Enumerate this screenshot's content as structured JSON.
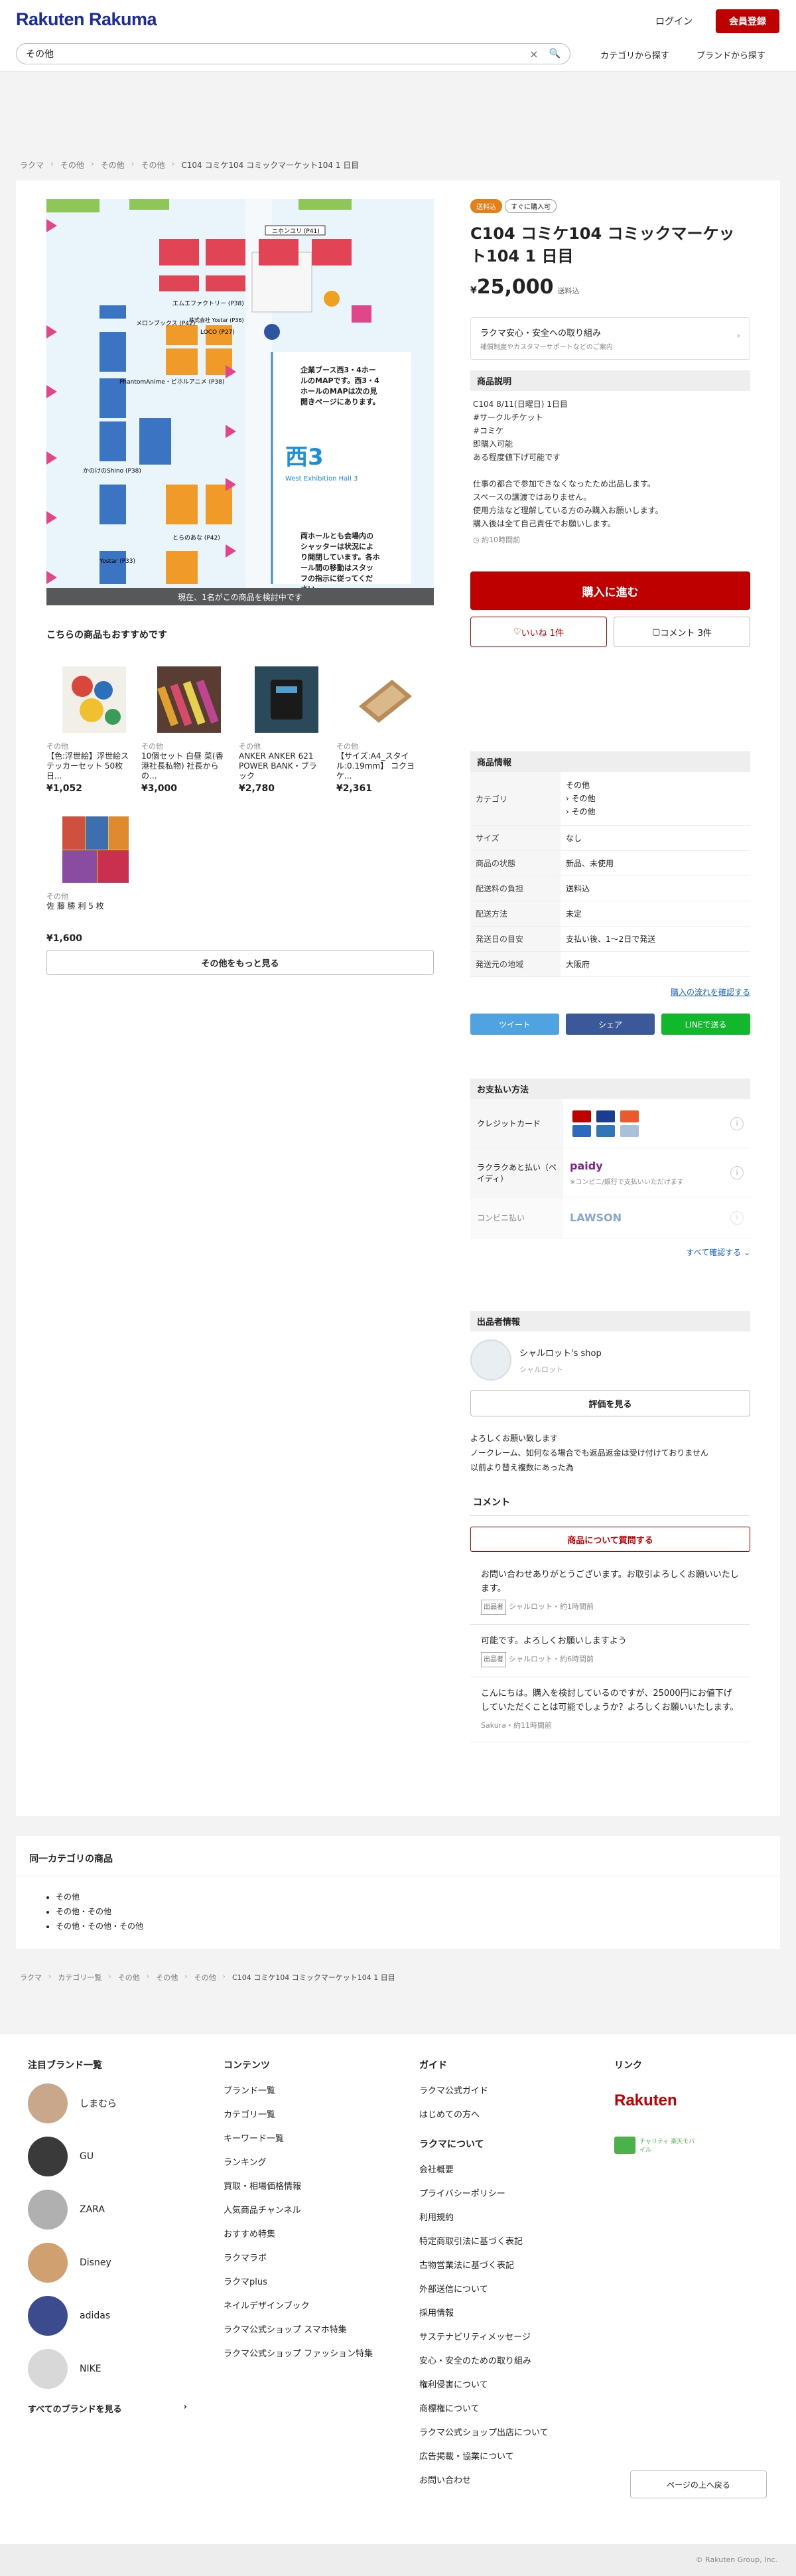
{
  "header": {
    "logo": "Rakuten Rakuma",
    "login": "ログイン",
    "register": "会員登録",
    "search_value": "その他",
    "clear_icon": "×",
    "search_icon": "🔍",
    "category_search": "カテゴリから探す",
    "brand_search": "ブランドから探す"
  },
  "breadcrumb_top": [
    "ラクマ",
    "その他",
    "その他",
    "その他",
    "C104 コミケ104 コミックマーケット104 1 日目"
  ],
  "photo": {
    "status": "現在、1名がこの商品を検討中です",
    "big_label": "西3",
    "hall_label": "West Exhibition Hall 3",
    "map_note1": "企業ブース西3・4ホールのMAPです。西3・4ホールのMAPは次の見開きページにあります。",
    "map_note2": "両ホールとも会場内のシャッターは状況により開閉しています。各ホール間の移動はスタッフの指示に従ってください。",
    "booths": [
      "ニホンユリ (P41)",
      "エムエファクトリー (P38)",
      "メロンブックス (P42)",
      "株式会社 Yostar (P36)",
      "LOCO (P27)",
      "PhantomAnime・ビホルアニメ (P38)",
      "かのけのShino (P38)",
      "とらのあな (P42)",
      "Yostar (P33)"
    ]
  },
  "recommend": {
    "title": "こちらの商品もおすすめです",
    "items": [
      {
        "cat": "その他",
        "name": "【色:浮世絵】浮世絵ステッカーセット 50枚 日...",
        "price": "¥1,052"
      },
      {
        "cat": "その他",
        "name": "10個セット 白昼 菜(香港社長私物) 社長からの...",
        "price": "¥3,000"
      },
      {
        "cat": "その他",
        "name": "ANKER ANKER 621 POWER BANK・ブラック",
        "price": "¥2,780"
      },
      {
        "cat": "その他",
        "name": "【サイズ:A4_スタイル:0.19mm】 コクヨ ケ...",
        "price": "¥2,361"
      },
      {
        "cat": "その他",
        "name": "佐 藤 勝 利 5 枚",
        "price": "¥1,600"
      }
    ],
    "more": "その他をもっと見る"
  },
  "product": {
    "badge_free": "送料込",
    "badge_now": "すぐに購入可",
    "title": "C104 コミケ104 コミックマーケット104 1 日目",
    "currency": "¥",
    "price": "25,000",
    "ship_note": "送料込",
    "safe_title": "ラクマ安心・安全への取り組み",
    "safe_sub": "補償制度やカスタマーサポートなどのご案内",
    "desc_title": "商品説明",
    "desc_lines": [
      "C104 8/11(日曜日) 1日目",
      "#サークルチケット",
      "#コミケ",
      "即購入可能",
      "ある程度値下げ可能です",
      "",
      "仕事の都合で参加できなくなったため出品します。",
      "スペースの譲渡ではありません。",
      "使用方法など理解している方のみ購入お願いします。",
      "購入後は全て自己責任でお願いします。"
    ],
    "posted": "約10時間前",
    "buy": "購入に進む",
    "like": "いいね 1件",
    "comment_btn": "コメント 3件"
  },
  "info": {
    "title": "商品情報",
    "rows": [
      {
        "k": "カテゴリ",
        "v": "その他\n› その他\n› その他"
      },
      {
        "k": "サイズ",
        "v": "なし"
      },
      {
        "k": "商品の状態",
        "v": "新品、未使用"
      },
      {
        "k": "配送料の負担",
        "v": "送料込"
      },
      {
        "k": "配送方法",
        "v": "未定"
      },
      {
        "k": "発送日の目安",
        "v": "支払い後、1〜2日で発送"
      },
      {
        "k": "発送元の地域",
        "v": "大阪府"
      }
    ],
    "flow_link": "購入の流れを確認する"
  },
  "share": {
    "tweet": "ツイート",
    "fb": "シェア",
    "line": "LINEで送る"
  },
  "payment": {
    "title": "お支払い方法",
    "credit": "クレジットカード",
    "paidy": "ラクラクあと払い（ペイディ）",
    "paidy_logo": "paidy",
    "paidy_note": "※コンビニ/銀行で支払いいただけます",
    "conv": "コンビニ払い",
    "lawson": "LAWSON",
    "see_all": "すべて確認する"
  },
  "seller": {
    "title": "出品者情報",
    "shop": "シャルロット's shop",
    "name": "シャルロット",
    "review_btn": "評価を見る",
    "bio": "よろしくお願い致します\nノークレーム、如何なる場合でも返品返金は受け付けておりません\n以前より替え複数にあった為"
  },
  "comments": {
    "title": "コメント",
    "ask": "商品について質問する",
    "items": [
      {
        "text": "お問い合わせありがとうございます。お取引よろしくお願いいたします。",
        "tag": "出品者",
        "meta": "シャルロット・約1時間前"
      },
      {
        "text": "可能です。よろしくお願いしますよう",
        "tag": "出品者",
        "meta": "シャルロット・約6時間前"
      },
      {
        "text": "こんにちは。購入を検討しているのですが、25000円にお値下げしていただくことは可能でしょうか？よろしくお願いいたします。",
        "tag": "",
        "meta": "Sakura・約11時間前"
      }
    ]
  },
  "same_cat": {
    "title": "同一カテゴリの商品",
    "links": [
      "その他",
      "その他・その他",
      "その他・その他・その他"
    ]
  },
  "breadcrumb_bottom": [
    "ラクマ",
    "カテゴリ一覧",
    "その他",
    "その他",
    "その他",
    "C104 コミケ104 コミックマーケット104 1 日目"
  ],
  "footer": {
    "brands_title": "注目ブランド一覧",
    "brands": [
      "しまむら",
      "GU",
      "ZARA",
      "Disney",
      "adidas",
      "NIKE"
    ],
    "all_brands": "すべてのブランドを見る",
    "contents_title": "コンテンツ",
    "contents": [
      "ブランド一覧",
      "カテゴリ一覧",
      "キーワード一覧",
      "ランキング",
      "買取・相場価格情報",
      "人気商品チャンネル",
      "おすすめ特集",
      "ラクマラボ",
      "ラクマplus",
      "ネイルデザインブック",
      "ラクマ公式ショップ スマホ特集",
      "ラクマ公式ショップ ファッション特集"
    ],
    "guide_title": "ガイド",
    "guide": [
      "ラクマ公式ガイド",
      "はじめての方へ"
    ],
    "about_title": "ラクマについて",
    "about": [
      "会社概要",
      "プライバシーポリシー",
      "利用規約",
      "特定商取引法に基づく表記",
      "古物営業法に基づく表記",
      "外部送信について",
      "採用情報",
      "サステナビリティメッセージ",
      "安心・安全のための取り組み",
      "権利侵害について",
      "商標権について",
      "ラクマ公式ショップ出店について",
      "広告掲載・協業について",
      "お問い合わせ"
    ],
    "links_title": "リンク",
    "rakuten": "Rakuten",
    "eco_label": "チャリティ 楽天モバイル",
    "back_top": "ページの上へ戻る",
    "copyright": "© Rakuten Group, Inc."
  }
}
